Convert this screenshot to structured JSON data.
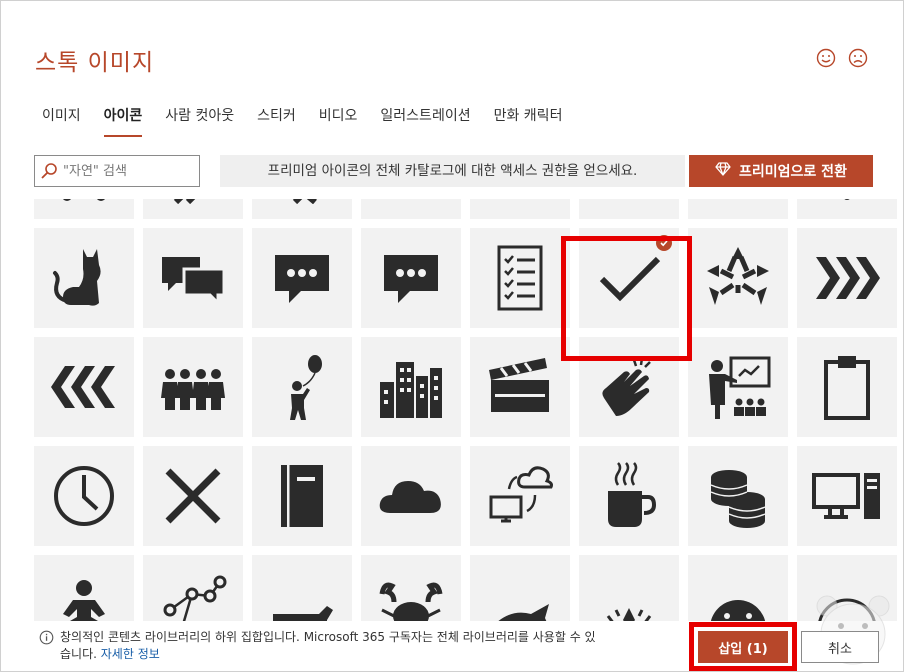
{
  "dialog": {
    "title": "스톡 이미지",
    "feedback_happy": "smile-icon",
    "feedback_sad": "frown-icon"
  },
  "tabs": [
    {
      "label": "이미지",
      "active": false
    },
    {
      "label": "아이콘",
      "active": true
    },
    {
      "label": "사람 컷아웃",
      "active": false
    },
    {
      "label": "스티커",
      "active": false
    },
    {
      "label": "비디오",
      "active": false
    },
    {
      "label": "일러스트레이션",
      "active": false
    },
    {
      "label": "만화 캐릭터",
      "active": false
    }
  ],
  "search": {
    "placeholder": "\"자연\" 검색",
    "value": ""
  },
  "premium": {
    "message": "프리미엄 아이콘의 전체 카탈로그에 대한 액세스 권한을 얻으세요.",
    "button_label": "프리미엄으로 전환",
    "button_icon": "diamond-icon"
  },
  "icons": [
    "partial-top-1",
    "partial-top-2",
    "partial-top-3",
    "partial-top-4",
    "partial-top-5",
    "partial-top-6",
    "partial-top-7",
    "partial-top-8",
    "cat-icon",
    "chat-bubbles-icon",
    "speech-bubble-icon",
    "speech-bubble-2-icon",
    "checklist-icon",
    "checkmark-icon",
    "hands-circle-icon",
    "chevrons-right-icon",
    "chevrons-left-icon",
    "group-of-people-icon",
    "person-with-balloon-icon",
    "city-buildings-icon",
    "clapperboard-icon",
    "clapping-hands-icon",
    "teacher-presentation-icon",
    "clipboard-icon",
    "clock-icon",
    "x-mark-icon",
    "book-icon",
    "cloud-icon",
    "cloud-sync-icon",
    "hot-coffee-icon",
    "coins-icon",
    "desktop-computer-icon",
    "meditation-icon",
    "network-icon",
    "cow-icon",
    "crab-icon",
    "fish-icon",
    "crown-icon",
    "face-icon",
    "bear-icon"
  ],
  "selected_icon": "checkmark-icon",
  "footer": {
    "info_text": "창의적인 콘텐츠 라이브러리의 하위 집합입니다. Microsoft 365 구독자는 전체 라이브러리를 사용할 수 있습니다.",
    "link_text": "자세한 정보",
    "insert_label": "삽입 (1)",
    "cancel_label": "취소"
  },
  "colors": {
    "accent": "#b7472a",
    "highlight": "#e60000",
    "tile_bg": "#f2f2f2",
    "icon": "#2b2b2b",
    "link": "#1a5fa8"
  }
}
